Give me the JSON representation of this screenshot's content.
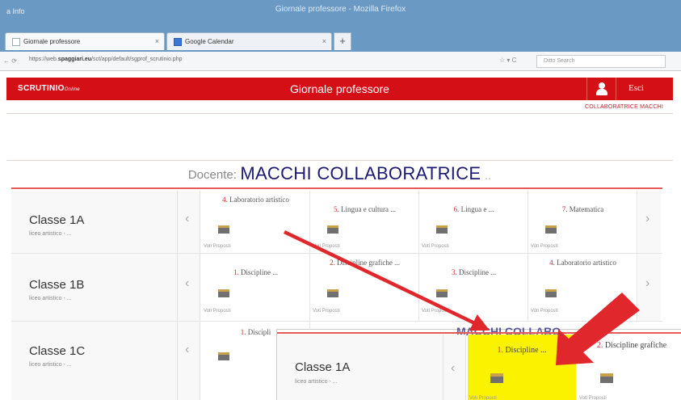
{
  "browser": {
    "window_title": "Giornale professore - Mozilla Firefox",
    "menu_label": "a  Info",
    "tabs": [
      {
        "label": "Giornale professore"
      },
      {
        "label": "Google Calendar"
      }
    ],
    "new_tab": "+",
    "close_glyph": "×",
    "nav": "← ⟳",
    "url_prefix": "https://web.",
    "url_domain": "spaggiari.eu",
    "url_rest": "/sct/app/default/sgprof_scrutinio.php",
    "nav_icons": "☆ ▾ C",
    "search_placeholder": "Ditto Search"
  },
  "app": {
    "logo": "SCRUTINIO",
    "logo_suffix": "Online",
    "title": "Giornale professore",
    "exit_label": "Esci",
    "user_name": "COLLABORATRICE MACCHI",
    "docente_label": "Docente:",
    "docente_name": "MACCHI COLLABORATRICE",
    "docente_ellipsis": "..",
    "voti_label": "Voti Proposti",
    "prev_glyph": "‹",
    "next_glyph": "›",
    "rows": [
      {
        "class_name": "Classe 1A",
        "sub": "liceo artistico - ...",
        "cells": [
          {
            "num": "4.",
            "name": "Laboratorio artistico"
          },
          {
            "num": "5.",
            "name": "Lingua e cultura ..."
          },
          {
            "num": "6.",
            "name": "Lingua e ..."
          },
          {
            "num": "7.",
            "name": "Matematica"
          }
        ]
      },
      {
        "class_name": "Classe 1B",
        "sub": "liceo artistico - ...",
        "cells": [
          {
            "num": "1.",
            "name": "Discipline ..."
          },
          {
            "num": "2.",
            "name": "Discipline grafiche ..."
          },
          {
            "num": "3.",
            "name": "Discipline ..."
          },
          {
            "num": "4.",
            "name": "Laboratorio artistico"
          }
        ]
      },
      {
        "class_name": "Classe 1C",
        "sub": "liceo artistico - ...",
        "cells": [
          {
            "num": "1.",
            "name": "Discipli"
          }
        ]
      }
    ]
  },
  "callout": {
    "class_name": "Classe 1A",
    "sub": "liceo artistico - ...",
    "ghost_text": "MACCHI COLLABO",
    "cell_highlight": {
      "num": "1.",
      "name": "Discipline ..."
    },
    "cell_next": {
      "num": "2.",
      "name": "Discipline grafiche"
    },
    "highlight_color": "#fbf200"
  },
  "colors": {
    "brand_red": "#d40f16",
    "arrow_red": "#e0282c",
    "docente_blue": "#1c1a72"
  }
}
